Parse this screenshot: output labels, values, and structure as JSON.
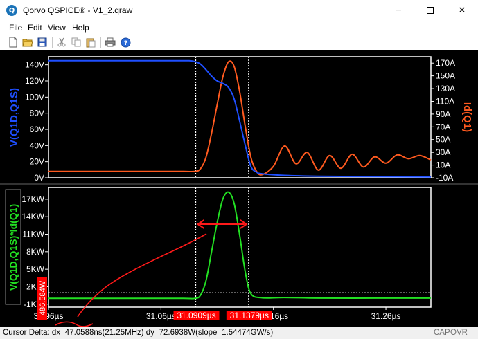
{
  "window": {
    "title": "Qorvo QSPICE® - V1_2.qraw",
    "icon_name": "qspice-logo-icon",
    "controls": {
      "minimize": "─",
      "maximize": "□",
      "close": "✕"
    }
  },
  "menu": {
    "items": [
      {
        "label": "File"
      },
      {
        "label": "Edit"
      },
      {
        "label": "View"
      },
      {
        "label": "Help"
      }
    ]
  },
  "toolbar": {
    "buttons": [
      {
        "name": "new-file-icon"
      },
      {
        "name": "open-folder-icon"
      },
      {
        "name": "save-icon"
      },
      {
        "name": "cut-icon"
      },
      {
        "name": "copy-icon"
      },
      {
        "name": "paste-icon"
      },
      {
        "name": "print-icon"
      },
      {
        "name": "help-icon"
      }
    ]
  },
  "colors": {
    "background": "#000000",
    "frame": "#ffffff",
    "voltage_trace": "#1f4fff",
    "current_trace": "#ff5a1f",
    "power_trace": "#22e022",
    "cursor_line": "#ffffff",
    "annotation": "#ff1a1a",
    "cursor_label_bg": "#ff0000"
  },
  "chart_data": [
    {
      "type": "line",
      "panel": "top",
      "y_left_label": "V(Q1D,Q1S)",
      "y_right_label": "Id(Q1)",
      "y_left_ticks": [
        "0V",
        "20V",
        "40V",
        "60V",
        "80V",
        "100V",
        "120V",
        "140V"
      ],
      "y_left_range": [
        0,
        150
      ],
      "y_right_ticks": [
        "-10A",
        "10A",
        "30A",
        "50A",
        "70A",
        "90A",
        "110A",
        "130A",
        "150A",
        "170A"
      ],
      "y_right_range": [
        -10,
        180
      ],
      "x_range": [
        30.96,
        31.3
      ],
      "grid": false,
      "series": [
        {
          "name": "V(Q1D,Q1S)",
          "axis": "left",
          "x": [
            30.96,
            31.0,
            31.05,
            31.08,
            31.085,
            31.09,
            31.095,
            31.1,
            31.105,
            31.11,
            31.115,
            31.12,
            31.125,
            31.13,
            31.135,
            31.14,
            31.145,
            31.15,
            31.17,
            31.2,
            31.25,
            31.3
          ],
          "values": [
            145,
            145,
            145,
            145,
            145,
            144,
            141,
            134,
            126,
            120,
            117,
            112,
            98,
            70,
            40,
            14,
            7,
            5,
            3,
            2,
            1.5,
            1
          ]
        },
        {
          "name": "Id(Q1)",
          "axis": "right",
          "x": [
            30.96,
            31.0,
            31.05,
            31.08,
            31.09,
            31.095,
            31.1,
            31.105,
            31.11,
            31.115,
            31.12,
            31.125,
            31.13,
            31.135,
            31.14,
            31.145,
            31.15,
            31.16,
            31.17,
            31.18,
            31.19,
            31.2,
            31.21,
            31.22,
            31.23,
            31.24,
            31.25,
            31.26,
            31.27,
            31.28,
            31.29,
            31.3
          ],
          "values": [
            0,
            0,
            0,
            0,
            0,
            4,
            22,
            60,
            105,
            148,
            172,
            165,
            125,
            70,
            22,
            0,
            -5,
            8,
            40,
            12,
            30,
            2,
            25,
            5,
            27,
            7,
            23,
            13,
            26,
            20,
            25,
            18
          ]
        }
      ]
    },
    {
      "type": "line",
      "panel": "bottom",
      "y_left_label": "V(Q1D,Q1S)*Id(Q1)",
      "y_left_ticks": [
        "-1KW",
        "2KW",
        "5KW",
        "8KW",
        "11KW",
        "14KW",
        "17KW"
      ],
      "y_left_range": [
        -1.5,
        19
      ],
      "x_ticks": [
        "30.96µs",
        "31.06µs",
        "31.16µs",
        "31.26µs"
      ],
      "x_range": [
        30.96,
        31.3
      ],
      "grid": false,
      "series": [
        {
          "name": "V(Q1D,Q1S)*Id(Q1)",
          "x": [
            30.96,
            31.0,
            31.05,
            31.08,
            31.09,
            31.095,
            31.1,
            31.105,
            31.11,
            31.115,
            31.12,
            31.125,
            31.13,
            31.135,
            31.14,
            31.15,
            31.17,
            31.2,
            31.25,
            31.3
          ],
          "values": [
            0,
            0,
            0,
            0,
            0,
            0.5,
            3,
            8,
            13,
            17,
            18.2,
            16.3,
            10.8,
            4.5,
            0.8,
            0.1,
            0.15,
            0.05,
            0.05,
            0.05
          ]
        }
      ],
      "horizontal_marker": {
        "label": "486.584W",
        "value": 0.486584
      }
    }
  ],
  "cursors": {
    "cursor1_label": "31.0909µs",
    "cursor1_x": 31.0909,
    "cursor2_label": "31.1379µs",
    "cursor2_x": 31.1379
  },
  "status": {
    "text": "Cursor Delta: dx=47.0588ns(21.25MHz)  dy=72.6938W(slope=1.54474GW/s)",
    "caps": "CAP",
    "ovr": "OVR"
  }
}
